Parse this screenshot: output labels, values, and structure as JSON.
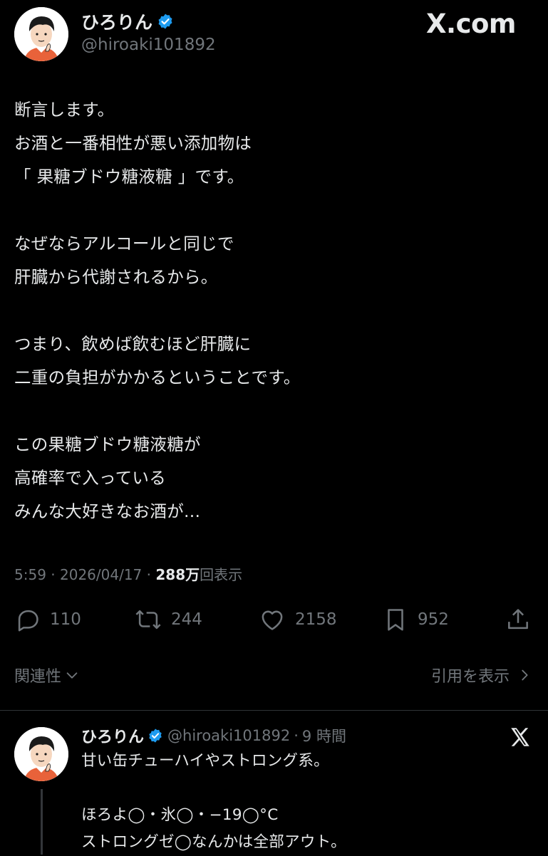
{
  "brand": {
    "logo_text": "X.com"
  },
  "main_tweet": {
    "author": {
      "display_name": "ひろりん",
      "handle": "@hiroaki101892"
    },
    "lines": [
      "断言します。",
      "お酒と一番相性が悪い添加物は",
      "「 果糖ブドウ糖液糖 」です。",
      "",
      "なぜならアルコールと同じで",
      "肝臓から代謝されるから。",
      "",
      "つまり、飲めば飲むほど肝臓に",
      "二重の負担がかかるということです。",
      "",
      "この果糖ブドウ糖液糖が",
      "高確率で入っている",
      "みんな大好きなお酒が..."
    ],
    "meta": {
      "time": "5:59",
      "sep1": " · ",
      "date": "2026/04/17",
      "sep2": " · ",
      "views": "288万",
      "views_suffix": "回表示"
    },
    "actions": {
      "replies": "110",
      "reposts": "244",
      "likes": "2158",
      "bookmarks": "952"
    },
    "related_label": "関連性",
    "quotes_label": "引用を表示"
  },
  "reply_tweet": {
    "author": {
      "display_name": "ひろりん",
      "handle": "@hiroaki101892",
      "time_sep": "·",
      "time": "9 時間"
    },
    "lines": [
      "甘い缶チューハイやストロング系。",
      "",
      "ほろよ◯・氷◯・−19◯°C",
      "ストロングゼ◯なんかは全部アウト。"
    ]
  },
  "colors": {
    "background": "#000000",
    "text": "#e7e9ea",
    "muted": "#71767b",
    "verified": "#1d9bf0",
    "divider": "#2f3336"
  },
  "icons": [
    "verified-badge-icon",
    "reply-icon",
    "repost-icon",
    "like-icon",
    "bookmark-icon",
    "share-icon",
    "chevron-down-icon",
    "chevron-right-icon",
    "x-logo-icon"
  ]
}
